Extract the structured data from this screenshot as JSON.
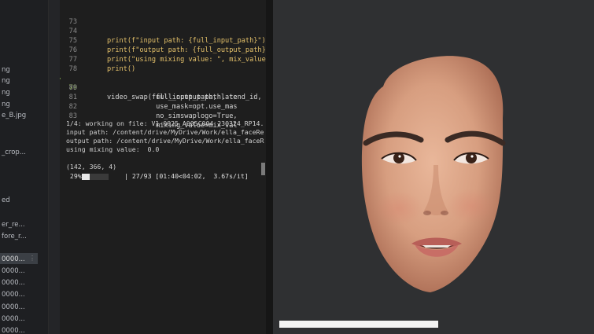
{
  "sidebar": {
    "items": [
      {
        "label": "ng",
        "selected": false
      },
      {
        "label": "ng",
        "selected": false
      },
      {
        "label": "ng",
        "selected": false
      },
      {
        "label": "ng",
        "selected": false
      },
      {
        "label": "e_B.jpg",
        "selected": false
      },
      {
        "label": "_crop...",
        "selected": false
      },
      {
        "label": "ed",
        "selected": false
      },
      {
        "label": "er_re...",
        "selected": false
      },
      {
        "label": "fore_r...",
        "selected": false
      },
      {
        "label": "0000...",
        "selected": true
      },
      {
        "label": "0000...",
        "selected": false
      },
      {
        "label": "0000...",
        "selected": false
      },
      {
        "label": "0000...",
        "selected": false
      },
      {
        "label": "0000...",
        "selected": false
      },
      {
        "label": "0000...",
        "selected": false
      },
      {
        "label": "0000...",
        "selected": false
      }
    ],
    "more_icon": "kebab-menu-icon"
  },
  "editor": {
    "lines": [
      {
        "num": "73",
        "text": ""
      },
      {
        "num": "74",
        "text": "print(f\"input path: {full_input_path}\")"
      },
      {
        "num": "75",
        "text": "print(f\"output path: {full_output_path}\""
      },
      {
        "num": "76",
        "text": "print(\"using mixing value: \", mix_value)"
      },
      {
        "num": "77",
        "text": "print()"
      },
      {
        "num": "78",
        "text": ""
      },
      {
        "num": "79",
        "text": "video_swap(full_input_path, latend_id, m"
      },
      {
        "num": "80",
        "text": "            full_output_path, te"
      },
      {
        "num": "81",
        "text": "            use_mask=opt.use_mas"
      },
      {
        "num": "82",
        "text": "            no_simswaplogo=True,"
      },
      {
        "num": "83",
        "text": "            mixing_value=mix_val"
      }
    ],
    "output_lines": [
      "1/4: working on file: V1-0025_A005C004_230324_RP14.",
      "input path: /content/drive/MyDrive/Work/ella_faceRe",
      "output path: /content/drive/MyDrive/Work/ella_faceR",
      "using mixing value:  0.0",
      "",
      "(142, 366, 4)"
    ],
    "progress": {
      "percent_text": " 29%|",
      "fraction": 0.29,
      "status_text": "| 27/93 [01:40<04:02,  3.67s/it]"
    }
  },
  "preview": {
    "playback_progress": 0.49
  },
  "colors": {
    "editor_bg": "#1e1e1e",
    "keyword_yellow": "#e4c16a",
    "boolean_blue": "#6fa7ff",
    "preview_bg": "#2f3032"
  }
}
